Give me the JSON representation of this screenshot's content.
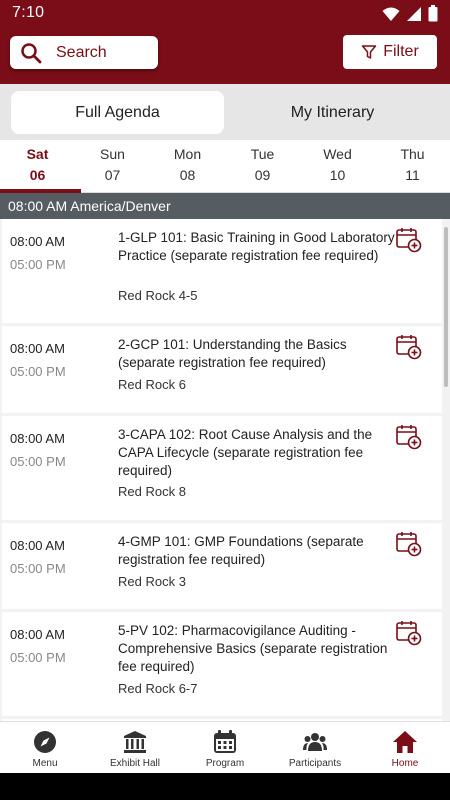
{
  "status": {
    "time": "7:10"
  },
  "header": {
    "search_label": "Search",
    "filter_label": "Filter"
  },
  "tabs": [
    {
      "label": "Full Agenda",
      "active": true
    },
    {
      "label": "My Itinerary",
      "active": false
    }
  ],
  "days": [
    {
      "dow": "Sat",
      "num": "06",
      "selected": true
    },
    {
      "dow": "Sun",
      "num": "07"
    },
    {
      "dow": "Mon",
      "num": "08"
    },
    {
      "dow": "Tue",
      "num": "09"
    },
    {
      "dow": "Wed",
      "num": "10"
    },
    {
      "dow": "Thu",
      "num": "11"
    }
  ],
  "timezone_header": "08:00 AM America/Denver",
  "sessions": [
    {
      "start": "08:00 AM",
      "end": "05:00 PM",
      "title": "1-GLP 101: Basic Training in Good Laboratory Practice (separate registration fee required)",
      "room": "Red Rock 4-5"
    },
    {
      "start": "08:00 AM",
      "end": "05:00 PM",
      "title": "2-GCP 101: Understanding the Basics (separate registration fee required)",
      "room": "Red Rock 6"
    },
    {
      "start": "08:00 AM",
      "end": "05:00 PM",
      "title": "3-CAPA 102: Root Cause Analysis and the CAPA Lifecycle (separate registration fee required)",
      "room": "Red Rock 8"
    },
    {
      "start": "08:00 AM",
      "end": "05:00 PM",
      "title": "4-GMP 101: GMP Foundations (separate registration fee required)",
      "room": "Red Rock 3"
    },
    {
      "start": "08:00 AM",
      "end": "05:00 PM",
      "title": "5-PV 102: Pharmacovigilance Auditing - Comprehensive Basics (separate registration fee required)",
      "room": "Red Rock 6-7"
    }
  ],
  "nav": [
    {
      "label": "Menu",
      "icon": "compass-icon"
    },
    {
      "label": "Exhibit Hall",
      "icon": "building-icon"
    },
    {
      "label": "Program",
      "icon": "calendar-icon"
    },
    {
      "label": "Participants",
      "icon": "people-icon"
    },
    {
      "label": "Home",
      "icon": "home-icon",
      "active": true
    }
  ],
  "colors": {
    "brand": "#7a0d17",
    "tz_bar": "#555d63"
  }
}
